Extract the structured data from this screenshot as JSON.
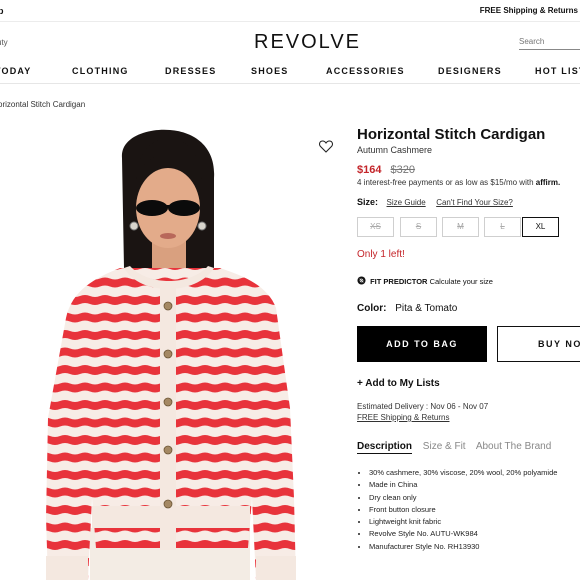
{
  "topbar": {
    "left_text": "p",
    "right_text": "FREE Shipping & Returns"
  },
  "header": {
    "beauty_partial": "uty",
    "logo": "REVOLVE",
    "search_placeholder": "Search"
  },
  "nav": {
    "items": [
      "TODAY",
      "CLOTHING",
      "DRESSES",
      "SHOES",
      "ACCESSORIES",
      "DESIGNERS",
      "HOT LIST"
    ]
  },
  "breadcrumb": "orizontal Stitch Cardigan",
  "product": {
    "title": "Horizontal Stitch Cardigan",
    "brand": "Autumn Cashmere",
    "sale_price": "$164",
    "original_price": "$320",
    "installments_text": "4 interest-free payments or as low as $15/mo with",
    "installments_provider": "affirm.",
    "size_label": "Size:",
    "size_guide": "Size Guide",
    "cant_find_size": "Can't Find Your Size?",
    "sizes": [
      {
        "label": "XS",
        "available": false
      },
      {
        "label": "S",
        "available": false
      },
      {
        "label": "M",
        "available": false
      },
      {
        "label": "L",
        "available": false
      },
      {
        "label": "XL",
        "available": true
      }
    ],
    "stock_message": "Only 1 left!",
    "fit_predictor_title": "FIT PREDICTOR",
    "fit_predictor_text": "Calculate your size",
    "color_label": "Color:",
    "color_value": "Pita & Tomato",
    "add_to_bag": "ADD TO BAG",
    "buy_now": "BUY NOW",
    "add_to_lists": "+ Add to My Lists",
    "delivery_text": "Estimated Delivery : Nov 06 - Nov 07",
    "shipping_link": "FREE Shipping & Returns",
    "tabs": [
      {
        "label": "Description",
        "active": true
      },
      {
        "label": "Size & Fit",
        "active": false
      },
      {
        "label": "About The Brand",
        "active": false
      }
    ],
    "details": [
      "30% cashmere, 30% viscose, 20% wool, 20% polyamide",
      "Made in China",
      "Dry clean only",
      "Front button closure",
      "Lightweight knit fabric",
      "Revolve Style No. AUTU-WK984",
      "Manufacturer Style No. RH13930"
    ]
  },
  "colors": {
    "sale_red": "#c4252a",
    "stripe_red": "#e8333b",
    "stripe_cream": "#f7ece6",
    "black": "#000000"
  },
  "icons": {
    "wishlist": "heart-icon",
    "fit_predictor": "ruler-icon"
  }
}
